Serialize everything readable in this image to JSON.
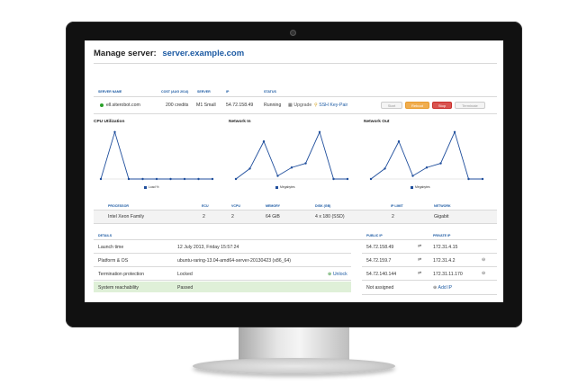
{
  "page": {
    "title_prefix": "Manage server:",
    "title_host": "server.example.com"
  },
  "server_table": {
    "headers": [
      "SERVER NAME",
      "COST (AUG 2014)",
      "SERVER",
      "IP",
      "STATUS"
    ],
    "row": {
      "name": "ell.siterobot.com",
      "cost": "200 credits",
      "server": "M1 Small",
      "ip": "54.72.158.49",
      "status": "Running",
      "upgrade": "Upgrade",
      "ssh": "SSH Key-Pair"
    },
    "buttons": {
      "start": "Start",
      "reboot": "Reboot",
      "stop": "Stop",
      "terminate": "Terminate"
    }
  },
  "charts": [
    {
      "title": "CPU Utilization",
      "legend": "Load %"
    },
    {
      "title": "Network In",
      "legend": "Megabytes"
    },
    {
      "title": "Network Out",
      "legend": "Megabytes"
    }
  ],
  "chart_data": [
    {
      "type": "line",
      "title": "CPU Utilization",
      "series": [
        {
          "name": "Load %",
          "values": [
            0,
            0.9,
            0,
            0,
            0,
            0,
            0,
            0,
            0
          ]
        }
      ],
      "color": "#1f4e9c"
    },
    {
      "type": "line",
      "title": "Network In",
      "series": [
        {
          "name": "Megabytes",
          "values": [
            0,
            0.2,
            0.72,
            0.06,
            0.22,
            0.3,
            0.9,
            0,
            0
          ]
        }
      ],
      "color": "#1f4e9c"
    },
    {
      "type": "line",
      "title": "Network Out",
      "series": [
        {
          "name": "Megabytes",
          "values": [
            0,
            0.2,
            0.72,
            0.06,
            0.22,
            0.3,
            0.9,
            0,
            0
          ]
        }
      ],
      "color": "#1f4e9c"
    }
  ],
  "specs": {
    "headers": [
      "PROCESSOR",
      "ECU",
      "VCPU",
      "MEMORY",
      "DISK (GB)",
      "IP LIMIT",
      "NETWORK"
    ],
    "values": [
      "Intel Xeon Family",
      "2",
      "2",
      "64 GiB",
      "4 x 180 (SSD)",
      "2",
      "Gigabit"
    ]
  },
  "details": {
    "header": "DETAILS",
    "rows": [
      {
        "label": "Launch time",
        "value": "12 July 2013, Friday 15:57:24"
      },
      {
        "label": "Platform & OS",
        "value": "ubuntu-raring-13.04-amd64-server-20130423 (x86_64)"
      },
      {
        "label": "Termination protection",
        "value": "Locked",
        "action": "Unlock"
      },
      {
        "label": "System reachability",
        "value": "Passed"
      }
    ]
  },
  "ips": {
    "public_header": "PUBLIC IP",
    "private_header": "PRIVATE IP",
    "rows": [
      {
        "public": "54.72.158.49",
        "private": "172.31.4.15"
      },
      {
        "public": "54.72.159.7",
        "private": "172.31.4.2"
      },
      {
        "public": "54.72.140.144",
        "private": "172.31.11.170"
      },
      {
        "public": "Not assigned",
        "private": "Add IP"
      }
    ]
  }
}
